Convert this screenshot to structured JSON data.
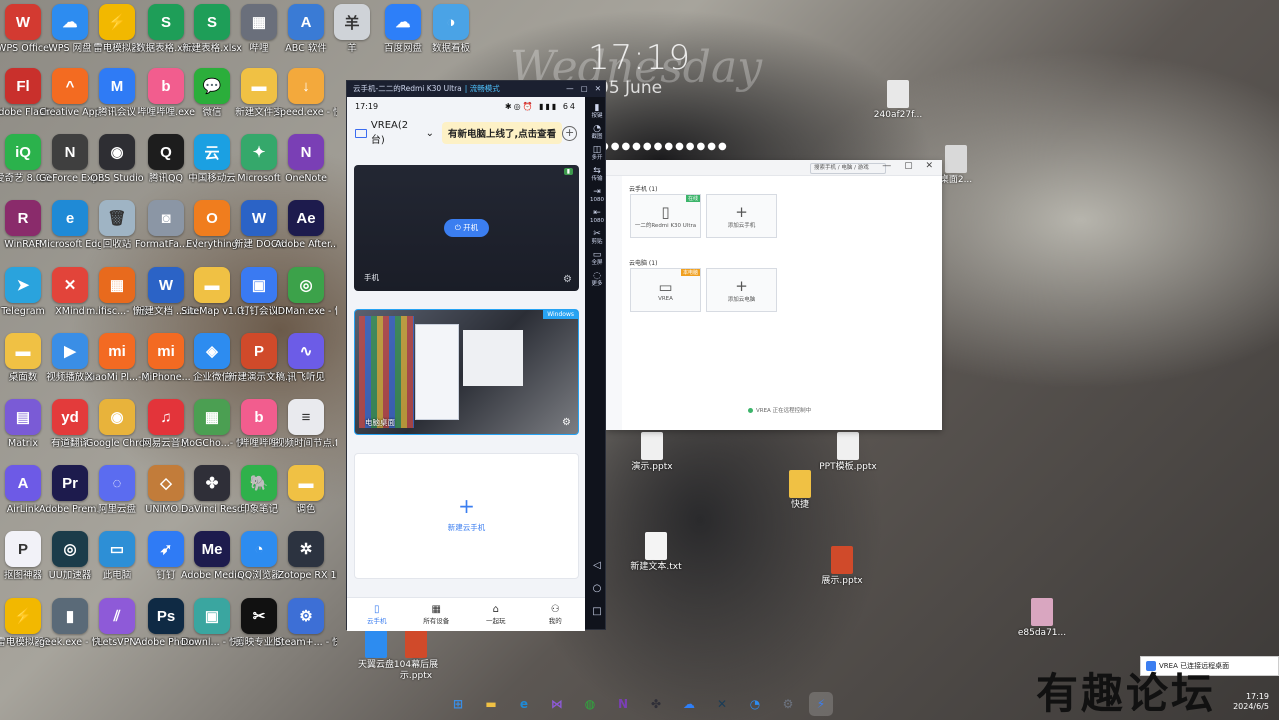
{
  "lockscreen": {
    "time": "17:19",
    "weekday": "Wednesday",
    "date": "05 June",
    "dots": "●●●●●●●●●●●●"
  },
  "desktop_icons": [
    {
      "label": "WPS Office",
      "glyph": "W",
      "color": "#d33a31",
      "col": 0,
      "row": 0
    },
    {
      "label": "WPS 网盘",
      "glyph": "☁",
      "color": "#2d8cf0",
      "col": 1,
      "row": 0
    },
    {
      "label": "雷电模拟器",
      "glyph": "⚡",
      "color": "#f2b800",
      "col": 2,
      "row": 0
    },
    {
      "label": "数据表格.xlsx",
      "glyph": "S",
      "color": "#1e9e58",
      "col": 3,
      "row": 0
    },
    {
      "label": "新建表格.xlsx",
      "glyph": "S",
      "color": "#1e9e58",
      "col": 4,
      "row": 0
    },
    {
      "label": "哔哩",
      "glyph": "▦",
      "color": "#6a6f7b",
      "col": 5,
      "row": 0
    },
    {
      "label": "ABC 软件",
      "glyph": "A",
      "color": "#3a7bd5",
      "col": 6,
      "row": 0
    },
    {
      "label": "羊",
      "glyph": "羊",
      "color": "#cfd3d8",
      "col": 7,
      "row": 0
    },
    {
      "label": "百度网盘",
      "glyph": "☁",
      "color": "#2d7ff9",
      "col": 8,
      "row": 0
    },
    {
      "label": "数据看板",
      "glyph": "◑",
      "color": "#4aa3e6",
      "col": 9,
      "row": 0
    },
    {
      "label": "Adobe Flash Pl...",
      "glyph": "Fl",
      "color": "#c9302c",
      "col": 0,
      "row": 1
    },
    {
      "label": "Creative App",
      "glyph": "^",
      "color": "#f36b21",
      "col": 1,
      "row": 1
    },
    {
      "label": "腾讯会议",
      "glyph": "M",
      "color": "#2f7bf5",
      "col": 2,
      "row": 1
    },
    {
      "label": "哔哩哔哩.exe",
      "glyph": "b",
      "color": "#f25d8e",
      "col": 3,
      "row": 1
    },
    {
      "label": "微信",
      "glyph": "💬",
      "color": "#2bae3b",
      "col": 4,
      "row": 1
    },
    {
      "label": "新建文件夹",
      "glyph": "▬",
      "color": "#f0c144",
      "col": 5,
      "row": 1
    },
    {
      "label": "speed.exe - 快捷方式",
      "glyph": "↓",
      "color": "#f3a93c",
      "col": 6,
      "row": 1
    },
    {
      "label": "爱奇艺 8.0.0",
      "glyph": "iQ",
      "color": "#2bb24c",
      "col": 0,
      "row": 2
    },
    {
      "label": "GeForce Experience",
      "glyph": "N",
      "color": "#3f3f3f",
      "col": 1,
      "row": 2
    },
    {
      "label": "OBS Studio",
      "glyph": "◉",
      "color": "#2e2e33",
      "col": 2,
      "row": 2
    },
    {
      "label": "腾讯QQ",
      "glyph": "Q",
      "color": "#1d1d1d",
      "col": 3,
      "row": 2
    },
    {
      "label": "中国移动云",
      "glyph": "云",
      "color": "#1ba0e2",
      "col": 4,
      "row": 2
    },
    {
      "label": "Microsoft",
      "glyph": "✦",
      "color": "#35a86b",
      "col": 5,
      "row": 2
    },
    {
      "label": "OneNote",
      "glyph": "N",
      "color": "#7a3fb5",
      "col": 6,
      "row": 2
    },
    {
      "label": "WinRAR",
      "glyph": "R",
      "color": "#8a2b6b",
      "col": 0,
      "row": 3
    },
    {
      "label": "Microsoft Edge",
      "glyph": "e",
      "color": "#1f8ad6",
      "col": 1,
      "row": 3
    },
    {
      "label": "回收站",
      "glyph": "🗑",
      "color": "#9fb4c4",
      "col": 2,
      "row": 3
    },
    {
      "label": "FormatFa...- 快捷方式",
      "glyph": "◙",
      "color": "#8b96a5",
      "col": 3,
      "row": 3
    },
    {
      "label": "Everything",
      "glyph": "O",
      "color": "#f07d1e",
      "col": 4,
      "row": 3
    },
    {
      "label": "新建 DOCX",
      "glyph": "W",
      "color": "#2b63c6",
      "col": 5,
      "row": 3
    },
    {
      "label": "Adobe After...",
      "glyph": "Ae",
      "color": "#1d1b4d",
      "col": 6,
      "row": 3
    },
    {
      "label": "Telegram",
      "glyph": "➤",
      "color": "#2aa3dd",
      "col": 0,
      "row": 4
    },
    {
      "label": "XMind",
      "glyph": "✕",
      "color": "#e2443a",
      "col": 1,
      "row": 4
    },
    {
      "label": "m.ifisc...- 快捷方式",
      "glyph": "▦",
      "color": "#e86a1d",
      "col": 2,
      "row": 4
    },
    {
      "label": "新建文档 ...docx",
      "glyph": "W",
      "color": "#2b63c6",
      "col": 3,
      "row": 4
    },
    {
      "label": "SiteMap v1.0.5",
      "glyph": "▬",
      "color": "#f0c144",
      "col": 4,
      "row": 4
    },
    {
      "label": "钉钉会议",
      "glyph": "▣",
      "color": "#3a7af2",
      "col": 5,
      "row": 4
    },
    {
      "label": "IDMan.exe - 快捷方式",
      "glyph": "◎",
      "color": "#3ca24a",
      "col": 6,
      "row": 4
    },
    {
      "label": "桌面数",
      "glyph": "▬",
      "color": "#f0c144",
      "col": 0,
      "row": 5
    },
    {
      "label": "视频播放器",
      "glyph": "▶",
      "color": "#3a8ee6",
      "col": 1,
      "row": 5
    },
    {
      "label": "XiaoMi Pl...- 快捷方式",
      "glyph": "mi",
      "color": "#f36a22",
      "col": 2,
      "row": 5
    },
    {
      "label": "MiPhone...",
      "glyph": "mi",
      "color": "#f36a22",
      "col": 3,
      "row": 5
    },
    {
      "label": "企业微信",
      "glyph": "◈",
      "color": "#2d8cf0",
      "col": 4,
      "row": 5
    },
    {
      "label": "新建演示文稿.pptx",
      "glyph": "P",
      "color": "#d04a2a",
      "col": 5,
      "row": 5
    },
    {
      "label": "讯飞听见",
      "glyph": "∿",
      "color": "#6c5ce7",
      "col": 6,
      "row": 5
    },
    {
      "label": "Matrix",
      "glyph": "▤",
      "color": "#7a5bd6",
      "col": 0,
      "row": 6
    },
    {
      "label": "有道翻译",
      "glyph": "yd",
      "color": "#e33b3b",
      "col": 1,
      "row": 6
    },
    {
      "label": "Google Chrome",
      "glyph": "◉",
      "color": "#e8b33b",
      "col": 2,
      "row": 6
    },
    {
      "label": "网易云音乐",
      "glyph": "♫",
      "color": "#e3343a",
      "col": 3,
      "row": 6
    },
    {
      "label": "MoGCho...- 快捷方式",
      "glyph": "▦",
      "color": "#4b9f52",
      "col": 4,
      "row": 6
    },
    {
      "label": "哔哩哔哩",
      "glyph": "b",
      "color": "#f25d8e",
      "col": 5,
      "row": 6
    },
    {
      "label": "视频时间节点.txt",
      "glyph": "≡",
      "color": "#e9eaee",
      "col": 6,
      "row": 6
    },
    {
      "label": "AirLink",
      "glyph": "A",
      "color": "#6d5ae6",
      "col": 0,
      "row": 7
    },
    {
      "label": "Adobe Prem...",
      "glyph": "Pr",
      "color": "#1d1b4d",
      "col": 1,
      "row": 7
    },
    {
      "label": "阿里云盘",
      "glyph": "◌",
      "color": "#5b6cf0",
      "col": 2,
      "row": 7
    },
    {
      "label": "UNIMO...",
      "glyph": "◇",
      "color": "#c27c3a",
      "col": 3,
      "row": 7
    },
    {
      "label": "DaVinci Resolve",
      "glyph": "✤",
      "color": "#2f2f38",
      "col": 4,
      "row": 7
    },
    {
      "label": "印象笔记",
      "glyph": "🐘",
      "color": "#2fb14b",
      "col": 5,
      "row": 7
    },
    {
      "label": "调色",
      "glyph": "▬",
      "color": "#f0c144",
      "col": 6,
      "row": 7
    },
    {
      "label": "抠图神器",
      "glyph": "P",
      "color": "#f2f2f8",
      "col": 0,
      "row": 8
    },
    {
      "label": "UU加速器",
      "glyph": "◎",
      "color": "#1b3c4a",
      "col": 1,
      "row": 8
    },
    {
      "label": "此电脑",
      "glyph": "▭",
      "color": "#2d8fd6",
      "col": 2,
      "row": 8
    },
    {
      "label": "钉钉",
      "glyph": "➶",
      "color": "#2f7bf5",
      "col": 3,
      "row": 8
    },
    {
      "label": "Adobe Media...",
      "glyph": "Me",
      "color": "#1d1b4d",
      "col": 4,
      "row": 8
    },
    {
      "label": "QQ浏览器",
      "glyph": "◔",
      "color": "#2d8cf0",
      "col": 5,
      "row": 8
    },
    {
      "label": "iZotope RX 10...",
      "glyph": "✲",
      "color": "#2c3340",
      "col": 6,
      "row": 8
    },
    {
      "label": "雷电模拟器9",
      "glyph": "⚡",
      "color": "#f2b800",
      "col": 0,
      "row": 9
    },
    {
      "label": "geek.exe - 快捷方式",
      "glyph": "▮",
      "color": "#5a6a78",
      "col": 1,
      "row": 9
    },
    {
      "label": "LetsVPN",
      "glyph": "⫽",
      "color": "#8e5ad8",
      "col": 2,
      "row": 9
    },
    {
      "label": "Adobe Photosho...",
      "glyph": "Ps",
      "color": "#0f2a44",
      "col": 3,
      "row": 9
    },
    {
      "label": "Downl... - 快捷方式",
      "glyph": "▣",
      "color": "#3aa6a0",
      "col": 4,
      "row": 9
    },
    {
      "label": "剪映专业版",
      "glyph": "✂",
      "color": "#111111",
      "col": 5,
      "row": 9
    },
    {
      "label": "Steam+... - 快捷方式",
      "glyph": "⚙",
      "color": "#3d6fd6",
      "col": 6,
      "row": 9
    }
  ],
  "phone_window": {
    "title": "云手机-二二的Redmi K30 Ultra",
    "mode": "| 流畅模式",
    "controls": [
      "—",
      "▢",
      "✕"
    ],
    "status_time": "17:19",
    "status_right": "✱◎⏰ ▮▮▮ 64",
    "device_selector": "VREA(2台)",
    "tip": "有新电脑上线了,点击查看",
    "cards": [
      {
        "badge": "",
        "action": "开机",
        "name": "手机"
      },
      {
        "badge": "Windows",
        "name": "电脑桌面"
      },
      {
        "plus": "+",
        "name": "新建云手机"
      }
    ],
    "nav": [
      {
        "glyph": "▯",
        "label": "云手机",
        "active": true
      },
      {
        "glyph": "▦",
        "label": "所有设备",
        "active": false
      },
      {
        "glyph": "⌂",
        "label": "一起玩",
        "active": false
      },
      {
        "glyph": "⚇",
        "label": "我的",
        "active": false
      }
    ],
    "sidebar": [
      {
        "glyph": "▮",
        "label": "按键"
      },
      {
        "glyph": "◔",
        "label": "截图"
      },
      {
        "glyph": "◫",
        "label": "多开"
      },
      {
        "glyph": "⇆",
        "label": "传输"
      },
      {
        "glyph": "⇥",
        "label": "1080"
      },
      {
        "glyph": "⇤",
        "label": "1080"
      },
      {
        "glyph": "✂",
        "label": "剪贴"
      },
      {
        "glyph": "▭",
        "label": "全屏"
      },
      {
        "glyph": "◌",
        "label": "更多"
      }
    ],
    "sidebar_bottom": [
      "◁",
      "○",
      "□"
    ]
  },
  "device_window": {
    "search": "搜索手机 / 电脑 / 游戏",
    "controls": "— ▢ ✕",
    "section1": "云手机 (1)",
    "section2": "云电脑 (1)",
    "tiles": [
      {
        "glyph": "▯",
        "label": "一二的Redmi K30 Ultra",
        "tag": "在线",
        "tagcolor": "#3cb46a"
      },
      {
        "glyph": "+",
        "label": "添加云手机",
        "tag": "",
        "tagcolor": ""
      },
      {
        "glyph": "▭",
        "label": "VREA",
        "tag": "本电脑",
        "tagcolor": "#f0a020"
      },
      {
        "glyph": "+",
        "label": "添加云电脑",
        "tag": "",
        "tagcolor": ""
      }
    ],
    "footnote": "VREA 正在远程控制中"
  },
  "right_files": [
    {
      "label": "240af27f...",
      "color": "#e8e8e8"
    },
    {
      "label": "桌面2...",
      "color": "#d9d9d9"
    },
    {
      "label": "演示.pptx",
      "color": "#f0f0f0"
    },
    {
      "label": "PPT模板.pptx",
      "color": "#f0f0f0"
    },
    {
      "label": "快捷",
      "color": "#f0c144"
    },
    {
      "label": "新建文本.txt",
      "color": "#f4f4f4"
    },
    {
      "label": "展示.pptx",
      "color": "#d04a2a"
    },
    {
      "label": "e85da71...",
      "color": "#d9a6c0"
    },
    {
      "label": "天翼云盘",
      "color": "#2d8cf0"
    },
    {
      "label": "104幕后展示.pptx",
      "color": "#d04a2a"
    }
  ],
  "taskbar": {
    "items": [
      {
        "glyph": "⊞",
        "color": "#3a8ee6",
        "name": "start"
      },
      {
        "glyph": "▬",
        "color": "#f0c144",
        "name": "explorer"
      },
      {
        "glyph": "e",
        "color": "#1f8ad6",
        "name": "edge"
      },
      {
        "glyph": "⋈",
        "color": "#8e5ad8",
        "name": "visual-studio"
      },
      {
        "glyph": "◍",
        "color": "#2bae3b",
        "name": "wechat"
      },
      {
        "glyph": "N",
        "color": "#7a3fb5",
        "name": "onenote"
      },
      {
        "glyph": "✤",
        "color": "#2f2f38",
        "name": "davinci"
      },
      {
        "glyph": "☁",
        "color": "#2d7ff9",
        "name": "baidu-netdisk"
      },
      {
        "glyph": "✕",
        "color": "#1a3c57",
        "name": "capcut"
      },
      {
        "glyph": "◔",
        "color": "#2d8cf0",
        "name": "qq-browser"
      },
      {
        "glyph": "⚙",
        "color": "#6d7480",
        "name": "settings"
      },
      {
        "glyph": "⚡",
        "color": "#3b7ef0",
        "name": "cloud-phone"
      }
    ],
    "tray_time": "17:19",
    "tray_date": "2024/6/5"
  },
  "notification": "VREA 已连接远程桌面",
  "watermark": "有趣论坛"
}
